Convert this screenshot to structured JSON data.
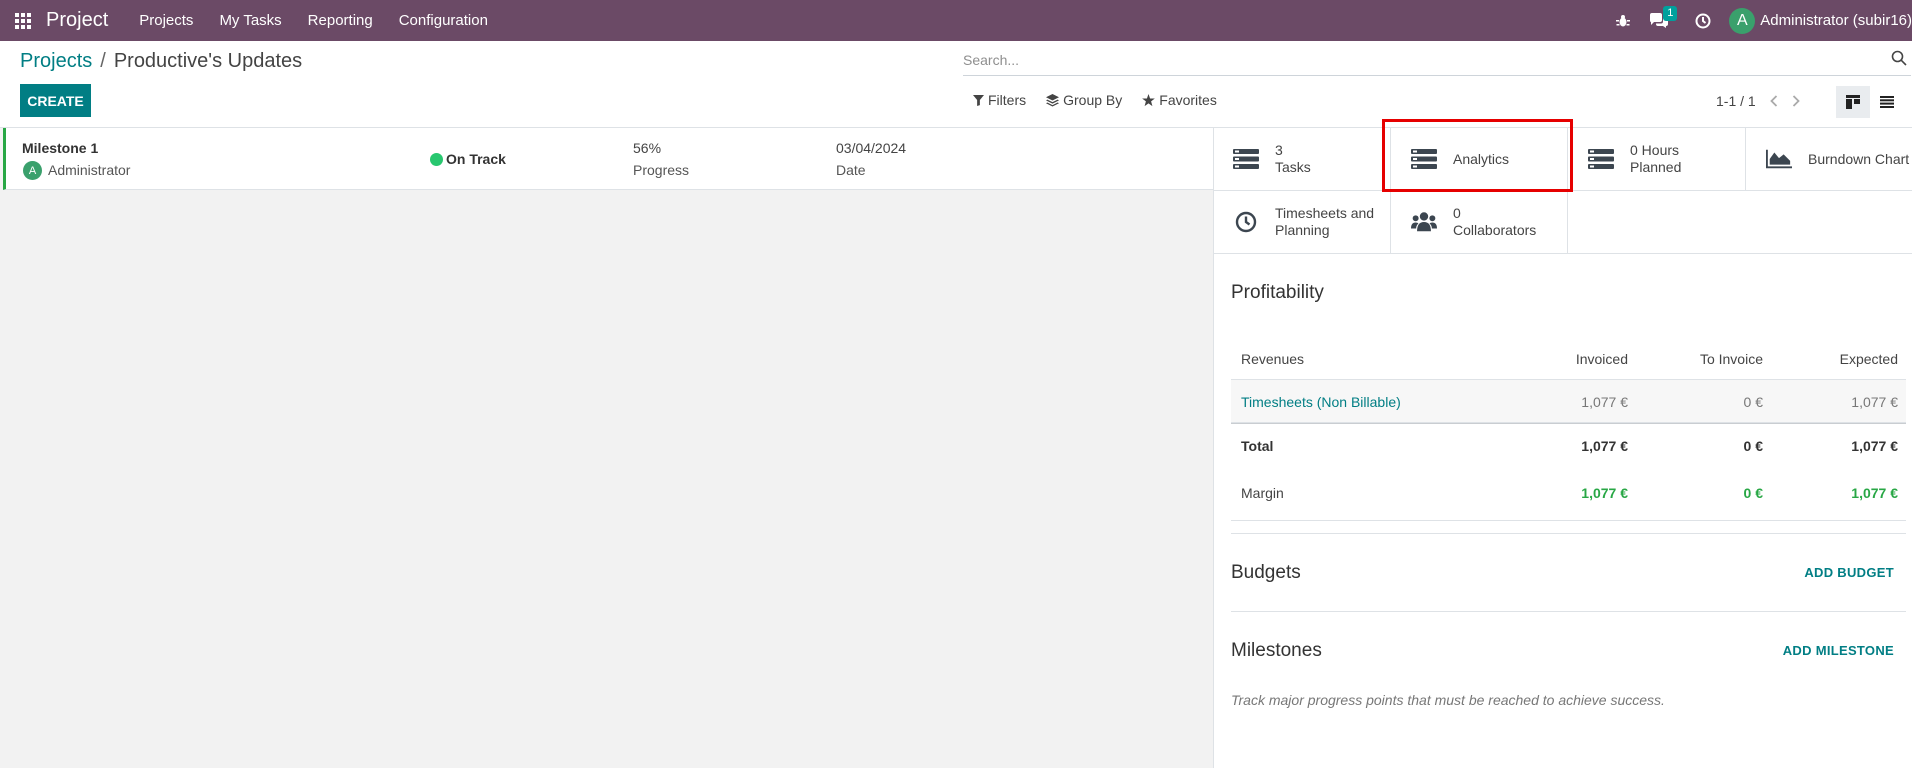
{
  "navbar": {
    "brand": "Project",
    "menu": [
      "Projects",
      "My Tasks",
      "Reporting",
      "Configuration"
    ],
    "chat_count": "1",
    "user_initial": "A",
    "user_name": "Administrator (subir16)"
  },
  "breadcrumb": {
    "parent": "Projects",
    "separator": "/",
    "current": "Productive's Updates"
  },
  "create_label": "CREATE",
  "search": {
    "placeholder": "Search..."
  },
  "search_options": {
    "filters": "Filters",
    "group_by": "Group By",
    "favorites": "Favorites"
  },
  "pager": "1-1 / 1",
  "milestone_row": {
    "name": "Milestone 1",
    "avatar_initial": "A",
    "user": "Administrator",
    "status": "On Track",
    "progress_value": "56%",
    "progress_label": "Progress",
    "date_value": "03/04/2024",
    "date_label": "Date"
  },
  "stats": {
    "tasks": {
      "value": "3",
      "label": "Tasks",
      "icon": "tasks-icon"
    },
    "analytics": {
      "label": "Analytics",
      "icon": "analytics-icon"
    },
    "planned": {
      "value": "0 Hours",
      "label": "Planned",
      "icon": "planned-icon"
    },
    "burndown": {
      "label": "Burndown Chart",
      "icon": "area-chart-icon"
    },
    "timesheets": {
      "line1": "Timesheets and",
      "line2": "Planning",
      "icon": "clock-icon"
    },
    "collaborators": {
      "value": "0",
      "label": "Collaborators",
      "icon": "users-icon"
    }
  },
  "profitability": {
    "title": "Profitability",
    "headers": [
      "Revenues",
      "Invoiced",
      "To Invoice",
      "Expected"
    ],
    "line": [
      "Timesheets (Non Billable)",
      "1,077 €",
      "0 €",
      "1,077 €"
    ],
    "total": [
      "Total",
      "1,077 €",
      "0 €",
      "1,077 €"
    ],
    "margin": [
      "Margin",
      "1,077 €",
      "0 €",
      "1,077 €"
    ]
  },
  "budgets": {
    "title": "Budgets",
    "action": "ADD BUDGET"
  },
  "milestones": {
    "title": "Milestones",
    "action": "ADD MILESTONE",
    "help": "Track major progress points that must be reached to achieve success."
  },
  "colors": {
    "navbar": "#6b4a66",
    "accent": "#017e84",
    "on_track": "#28c76f",
    "positive": "#28a745",
    "highlight": "#e60000"
  }
}
